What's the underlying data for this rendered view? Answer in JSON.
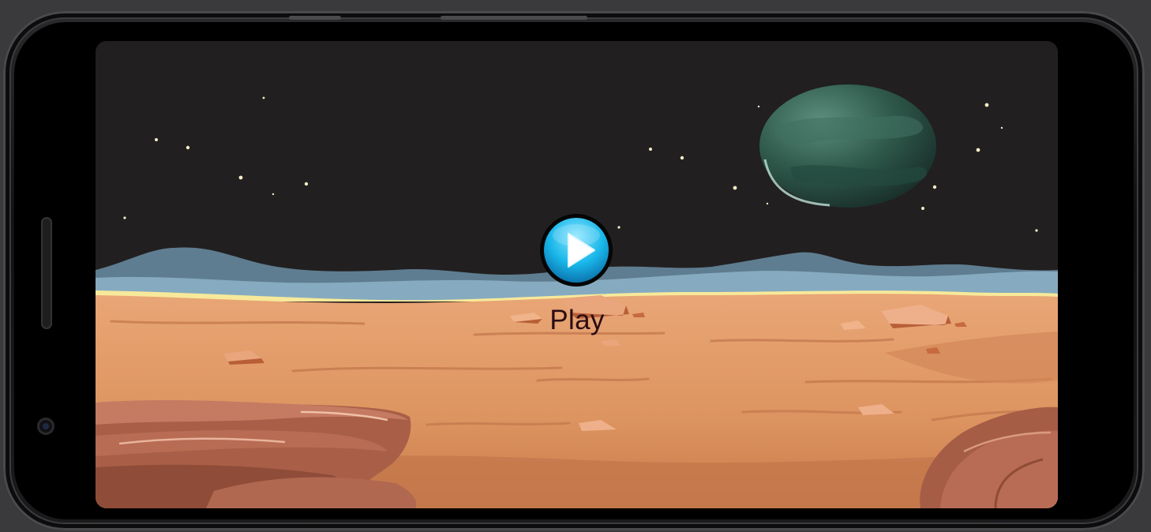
{
  "game": {
    "play_label": "Play"
  },
  "colors": {
    "sky": "#221f20",
    "planet": "#2f5a4c",
    "hills": "#6e8fa4",
    "sand": "#e09a6a",
    "rock": "#b86a4c",
    "play_button": "#19b7ea",
    "label_text": "#2a0d12"
  },
  "icons": {
    "play": "play-triangle-icon",
    "planet": "planet-icon"
  }
}
